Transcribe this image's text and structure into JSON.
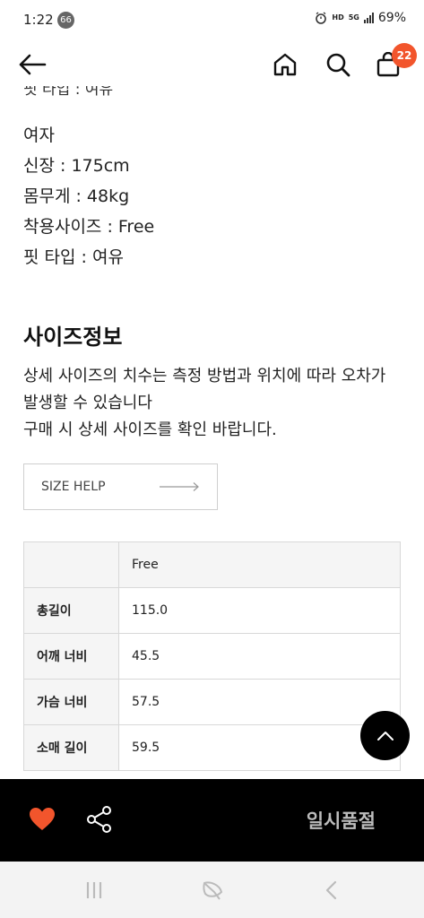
{
  "status": {
    "time": "1:22",
    "notification_count": "66",
    "hd_label": "HD",
    "network_label": "5G",
    "battery": "69%"
  },
  "header": {
    "cart_count": "22"
  },
  "model": {
    "cut_line": "핏 타입 : 여유",
    "gender": "여자",
    "height": "신장 : 175cm",
    "weight": "몸무게 : 48kg",
    "wear_size": "착용사이즈 : Free",
    "fit_type": "핏 타입 : 여유"
  },
  "size_info": {
    "title": "사이즈정보",
    "desc_line1": "상세 사이즈의 치수는 측정 방법과 위치에 따라 오차가 발생할 수 있습니다",
    "desc_line2": "구매 시 상세 사이즈를 확인 바랍니다.",
    "help_button": "SIZE HELP",
    "table": {
      "header": [
        "",
        "Free"
      ],
      "rows": [
        {
          "label": "총길이",
          "value": "115.0"
        },
        {
          "label": "어깨 너비",
          "value": "45.5"
        },
        {
          "label": "가슴 너비",
          "value": "57.5"
        },
        {
          "label": "소매 길이",
          "value": "59.5"
        }
      ]
    }
  },
  "bottom_bar": {
    "status": "일시품절"
  },
  "colors": {
    "accent": "#f2552c",
    "bar": "#000000",
    "soldout_text": "#bcbcbc"
  }
}
